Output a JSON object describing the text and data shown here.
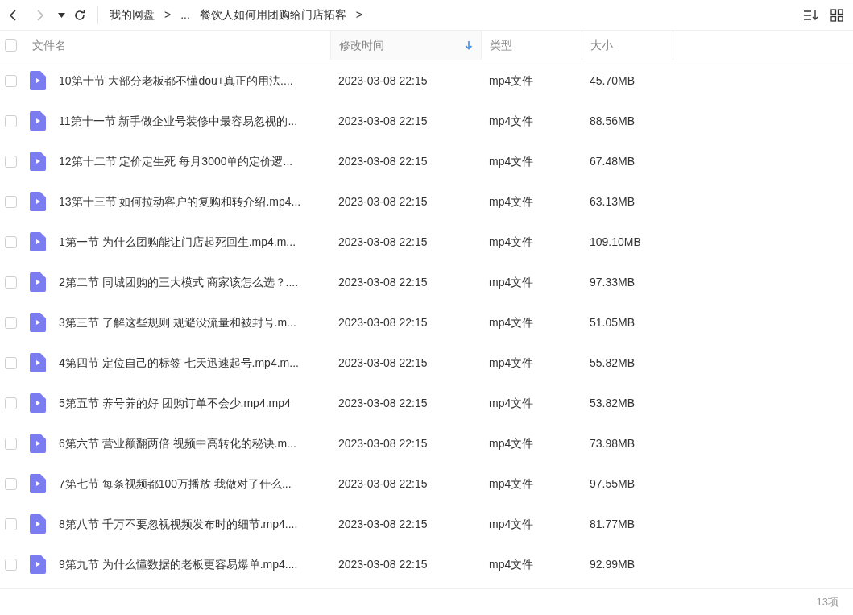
{
  "breadcrumb": [
    "我的网盘",
    ">",
    "...",
    "餐饮人如何用团购给门店拓客",
    ">"
  ],
  "columns": [
    {
      "label": "文件名",
      "sorted": false
    },
    {
      "label": "修改时间",
      "sorted": true
    },
    {
      "label": "类型",
      "sorted": false
    },
    {
      "label": "大小",
      "sorted": false
    }
  ],
  "rows": [
    {
      "name": "10第十节 大部分老板都不懂dou+真正的用法....",
      "modified": "2023-03-08 22:15",
      "type": "mp4文件",
      "size": "45.70MB",
      "checked": false
    },
    {
      "name": "11第十一节 新手做企业号装修中最容易忽视的...",
      "modified": "2023-03-08 22:15",
      "type": "mp4文件",
      "size": "88.56MB",
      "checked": false
    },
    {
      "name": "12第十二节 定价定生死 每月3000单的定价逻...",
      "modified": "2023-03-08 22:15",
      "type": "mp4文件",
      "size": "67.48MB",
      "checked": false
    },
    {
      "name": "13第十三节 如何拉动客户的复购和转介绍.mp4...",
      "modified": "2023-03-08 22:15",
      "type": "mp4文件",
      "size": "63.13MB",
      "checked": false
    },
    {
      "name": "1第一节 为什么团购能让门店起死回生.mp4.m...",
      "modified": "2023-03-08 22:15",
      "type": "mp4文件",
      "size": "109.10MB",
      "checked": false
    },
    {
      "name": "2第二节 同城团购的三大模式 商家该怎么选？....",
      "modified": "2023-03-08 22:15",
      "type": "mp4文件",
      "size": "97.33MB",
      "checked": false
    },
    {
      "name": "3第三节 了解这些规则 规避没流量和被封号.m...",
      "modified": "2023-03-08 22:15",
      "type": "mp4文件",
      "size": "51.05MB",
      "checked": false
    },
    {
      "name": "4第四节 定位自己的标签 七天迅速起号.mp4.m...",
      "modified": "2023-03-08 22:15",
      "type": "mp4文件",
      "size": "55.82MB",
      "checked": false
    },
    {
      "name": "5第五节 养号养的好 团购订单不会少.mp4.mp4",
      "modified": "2023-03-08 22:15",
      "type": "mp4文件",
      "size": "53.82MB",
      "checked": false
    },
    {
      "name": "6第六节 营业额翻两倍 视频中高转化的秘诀.m...",
      "modified": "2023-03-08 22:15",
      "type": "mp4文件",
      "size": "73.98MB",
      "checked": false
    },
    {
      "name": "7第七节 每条视频都100万播放 我做对了什么...",
      "modified": "2023-03-08 22:15",
      "type": "mp4文件",
      "size": "97.55MB",
      "checked": false
    },
    {
      "name": "8第八节 千万不要忽视视频发布时的细节.mp4....",
      "modified": "2023-03-08 22:15",
      "type": "mp4文件",
      "size": "81.77MB",
      "checked": false
    },
    {
      "name": "9第九节 为什么懂数据的老板更容易爆单.mp4....",
      "modified": "2023-03-08 22:15",
      "type": "mp4文件",
      "size": "92.99MB",
      "checked": false
    }
  ],
  "select_all": {
    "checked": false
  },
  "status_bar": {
    "count": "13项"
  }
}
